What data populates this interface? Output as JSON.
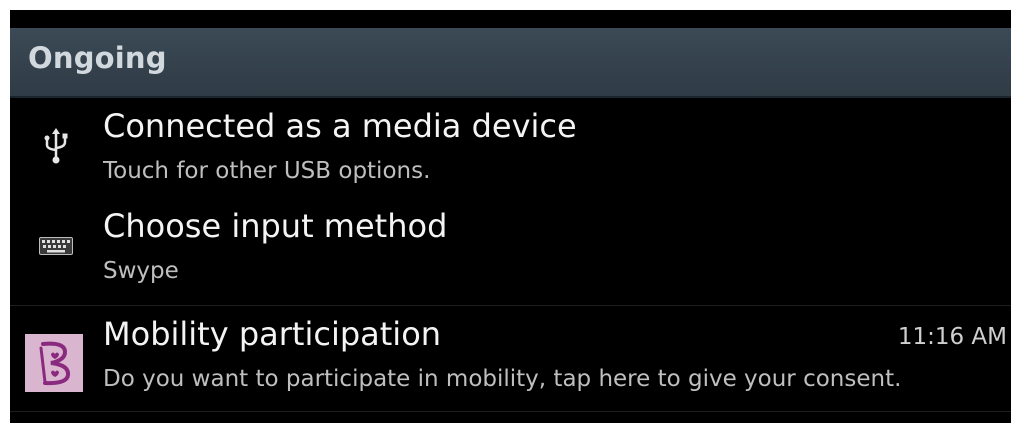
{
  "section": {
    "title": "Ongoing"
  },
  "notifications": [
    {
      "icon": "usb-icon",
      "title": "Connected as a media device",
      "text": "Touch for other USB options.",
      "time": ""
    },
    {
      "icon": "keyboard-icon",
      "title": "Choose input method",
      "text": "Swype",
      "time": ""
    },
    {
      "icon": "mobility-app-icon",
      "title": "Mobility participation",
      "text": "Do you want to participate in mobility, tap here to give your consent.",
      "time": "11:16 AM"
    }
  ],
  "colors": {
    "header_bg": "#34424d",
    "header_text": "#d2d9de",
    "title_text": "#f4f4f4",
    "body_text": "#bfbfbf",
    "app_icon_bg": "#d9b5cf",
    "app_icon_accent": "#8a2a7e"
  }
}
